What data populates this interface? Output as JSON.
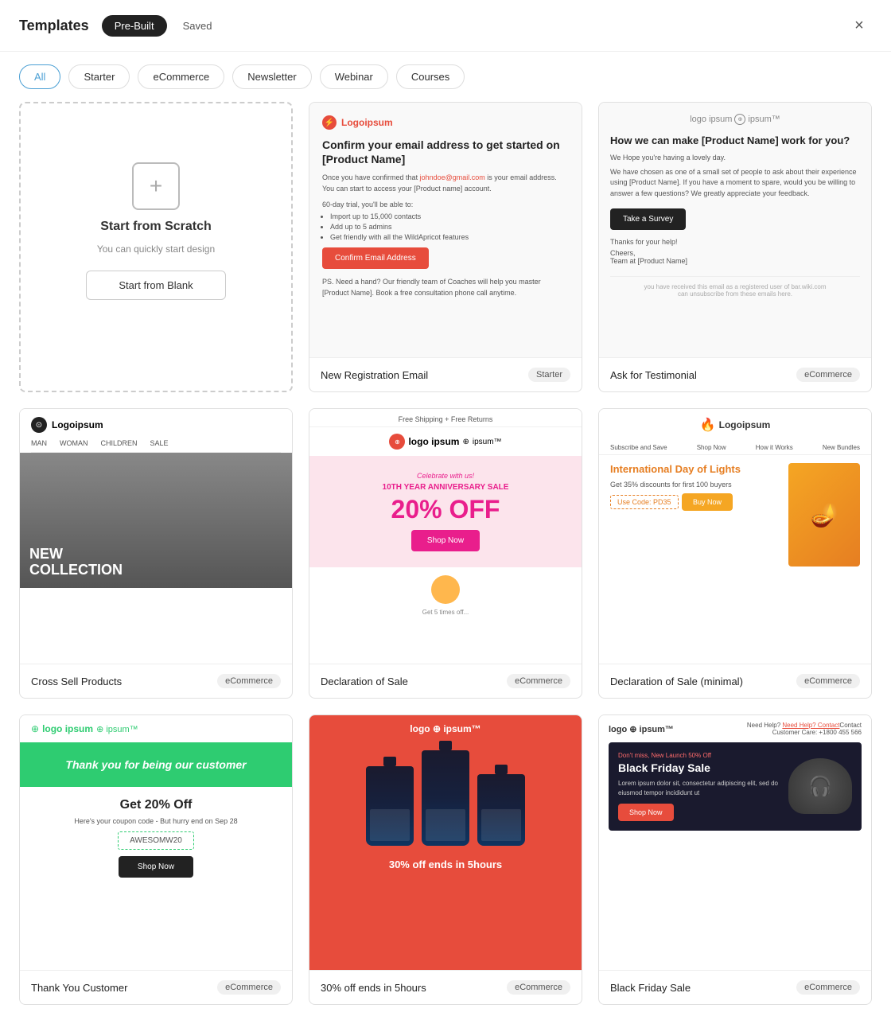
{
  "header": {
    "title": "Templates",
    "close_label": "×",
    "tabs": [
      {
        "id": "prebuilt",
        "label": "Pre-Built",
        "active": true
      },
      {
        "id": "saved",
        "label": "Saved",
        "active": false
      }
    ]
  },
  "filters": [
    {
      "id": "all",
      "label": "All",
      "active": true
    },
    {
      "id": "starter",
      "label": "Starter",
      "active": false
    },
    {
      "id": "ecommerce",
      "label": "eCommerce",
      "active": false
    },
    {
      "id": "newsletter",
      "label": "Newsletter",
      "active": false
    },
    {
      "id": "webinar",
      "label": "Webinar",
      "active": false
    },
    {
      "id": "courses",
      "label": "Courses",
      "active": false
    }
  ],
  "cards": [
    {
      "id": "scratch",
      "type": "scratch",
      "title": "Start from Scratch",
      "subtitle": "You can quickly start design",
      "button": "Start from Blank"
    },
    {
      "id": "new-registration",
      "name": "New Registration Email",
      "tag": "Starter",
      "logo": "Logoipsum",
      "preview": {
        "title": "Confirm your email address to get started on [Product Name]",
        "body": "Once you have confirmed that johndoe@gmail.com is your email address. You can start to access your [Product name] account.",
        "trial_label": "60-day trial, you'll be able to:",
        "features": [
          "Import up to 15,000 contacts",
          "Add up to 5 admins",
          "Get friendly with all the WildApricot features"
        ],
        "cta": "Confirm Email Address",
        "ps": "PS. Need a hand? Our friendly team of Coaches will help you master [Product Name]. Book a free consultation phone call anytime."
      }
    },
    {
      "id": "ask-testimonial",
      "name": "Ask for Testimonial",
      "tag": "eCommerce",
      "logo": "logo ipsum",
      "preview": {
        "title": "How we can make [Product Name] work for you?",
        "greeting": "We Hope you're having a lovely day.",
        "body": "We have chosen as one of a small set of people to ask about their experience using [Product Name]. If you have a moment to spare, would you be willing to answer a few questions? We greatly appreciate your feedback.",
        "cta": "Take a Survey",
        "thanks": "Thanks for your help!",
        "sign": "Cheers,\nTeam at [Product Name]",
        "footer": "you have received this email as a registered user of bar.wiki.com\ncan unsubscribe from these emails here."
      }
    },
    {
      "id": "cross-sell",
      "name": "Cross Sell Products",
      "tag": "eCommerce",
      "logo": "Logoipsum",
      "preview": {
        "nav": [
          "MAN",
          "WOMAN",
          "CHILDREN",
          "SALE"
        ],
        "banner_text": "NEW\nCOLLECTION"
      }
    },
    {
      "id": "declaration-sale",
      "name": "Declaration of Sale",
      "tag": "eCommerce",
      "logo": "logo ipsum",
      "preview": {
        "shipping": "Free Shipping  +  Free Returns",
        "celebrate": "Celebrate with us!",
        "year": "10TH YEAR ANNIVERSARY SALE",
        "percent": "20% OFF",
        "cta": "Shop Now"
      }
    },
    {
      "id": "declaration-sale-minimal",
      "name": "Declaration of Sale (minimal)",
      "tag": "eCommerce",
      "logo": "Logoipsum",
      "preview": {
        "title": "International Day of Lights",
        "subtitle": "Get 35% discounts for first 100 buyers",
        "code": "Use Code: PD35",
        "cta": "Buy Now",
        "nav": [
          "Subscribe and Save",
          "Shop Now",
          "How it Works",
          "New Bundles"
        ]
      }
    },
    {
      "id": "thank-you",
      "name": "Thank You Customer",
      "tag": "eCommerce",
      "logo": "logo ipsum",
      "preview": {
        "banner": "Thank you for being our customer",
        "offer": "Get 20% Off",
        "subtitle": "Here's your coupon code - But hurry end on Sep 28",
        "code": "AWESOMW20",
        "cta": "Shop Now"
      }
    },
    {
      "id": "perfume",
      "name": "30% off ends in 5hours",
      "tag": "eCommerce",
      "logo": "logo ipsum",
      "preview": {
        "text": "30% off ends in 5hours"
      }
    },
    {
      "id": "black-friday",
      "name": "Black Friday Sale",
      "tag": "eCommerce",
      "logo": "logo ipsum",
      "preview": {
        "help_text": "Need Help? Contact",
        "care": "Customer Care: +1800 455 566",
        "tag": "Don't miss, New Launch 50% Off",
        "title": "Black Friday Sale",
        "body": "Lorem ipsum dolor sit, consectetur adipiscing elit, sed do eiusmod tempor incididunt ut",
        "cta": "Shop Now"
      }
    }
  ]
}
